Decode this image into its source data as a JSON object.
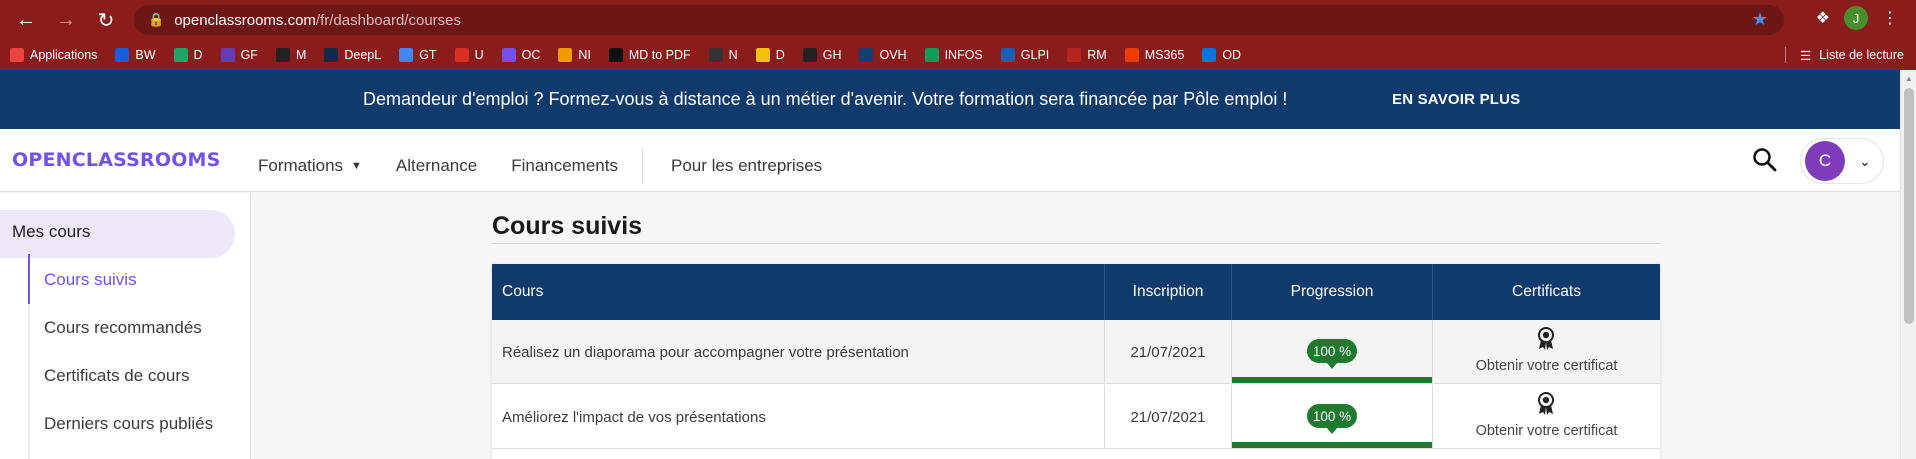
{
  "browser": {
    "url_host": "openclassrooms.com",
    "url_path": "/fr/dashboard/courses",
    "profile_initial": "J",
    "bookmarks": [
      {
        "label": "Applications",
        "color": "#e8453c"
      },
      {
        "label": "BW",
        "color": "#175ddc"
      },
      {
        "label": "D",
        "color": "#1fa463"
      },
      {
        "label": "GF",
        "color": "#673ab7"
      },
      {
        "label": "M",
        "color": "#222222"
      },
      {
        "label": "DeepL",
        "color": "#0f2b46"
      },
      {
        "label": "GT",
        "color": "#4285f4"
      },
      {
        "label": "U",
        "color": "#d93025"
      },
      {
        "label": "OC",
        "color": "#7451eb"
      },
      {
        "label": "NI",
        "color": "#f29900"
      },
      {
        "label": "MD to PDF",
        "color": "#111111"
      },
      {
        "label": "N",
        "color": "#333333"
      },
      {
        "label": "D",
        "color": "#f4c20d"
      },
      {
        "label": "GH",
        "color": "#222222"
      },
      {
        "label": "OVH",
        "color": "#123f6d"
      },
      {
        "label": "INFOS",
        "color": "#0f9d58"
      },
      {
        "label": "GLPI",
        "color": "#1a5fb4"
      },
      {
        "label": "RM",
        "color": "#b3261e"
      },
      {
        "label": "MS365",
        "color": "#eb3c00"
      },
      {
        "label": "OD",
        "color": "#0a74da"
      }
    ],
    "reading_list": "Liste de lecture"
  },
  "banner": {
    "text": "Demandeur d'emploi ? Formez-vous à distance à un métier d'avenir. Votre formation sera financée par Pôle emploi !",
    "cta": "EN SAVOIR PLUS"
  },
  "header": {
    "logo": "OPENCLASSROOMS",
    "nav": {
      "formations": "Formations",
      "alternance": "Alternance",
      "financements": "Financements",
      "entreprises": "Pour les entreprises"
    },
    "avatar_initial": "C"
  },
  "sidebar": {
    "title": "Mes cours",
    "items": [
      "Cours suivis",
      "Cours recommandés",
      "Certificats de cours",
      "Derniers cours publiés"
    ]
  },
  "main": {
    "title": "Cours suivis",
    "columns": [
      "Cours",
      "Inscription",
      "Progression",
      "Certificats"
    ],
    "rows": [
      {
        "course": "Réalisez un diaporama pour accompagner votre présentation",
        "date": "21/07/2021",
        "progress_label": "100 %",
        "progress": 1.0,
        "certificate": "Obtenir votre certificat"
      },
      {
        "course": "Améliorez l'impact de vos présentations",
        "date": "21/07/2021",
        "progress_label": "100 %",
        "progress": 1.0,
        "certificate": "Obtenir votre certificat"
      }
    ]
  },
  "colors": {
    "brand": "#7451eb",
    "navy": "#0f3a6b",
    "progress": "#1f7a30",
    "browser": "#8a1c1c"
  }
}
